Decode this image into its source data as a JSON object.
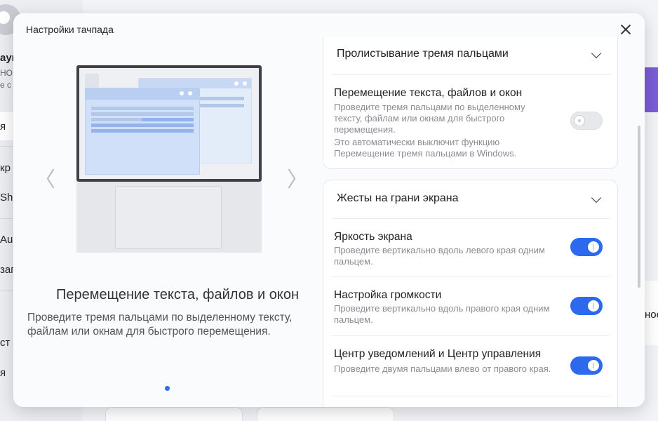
{
  "background": {
    "sidebar_fragments": [
      "аун",
      "HOM",
      "е с",
      "я",
      "кр",
      "Sh",
      "Aud",
      "зап",
      "ст",
      "я"
    ],
    "right_fragment": "ное"
  },
  "dialog": {
    "title": "Настройки тачпада",
    "close_icon": "close-icon"
  },
  "preview": {
    "prev_arrow": "〈",
    "next_arrow": "〉",
    "feature_title": "Перемещение текста, файлов и окон",
    "feature_description": "Проведите тремя пальцами по выделенному тексту, файлам или окнам для быстрого перемещения.",
    "page_indicator": "1"
  },
  "settings": {
    "three_finger_section": {
      "header": "Пролистывание тремя пальцами",
      "items": [
        {
          "title": "Перемещение текста, файлов и окон",
          "description": "Проведите тремя пальцами по выделенному тексту, файлам или окнам для быстрого перемещения.",
          "note": "Это автоматически выключит функцию Перемещение тремя пальцами в Windows.",
          "enabled": false
        }
      ]
    },
    "edge_section": {
      "header": "Жесты на грани экрана",
      "items": [
        {
          "title": "Яркость экрана",
          "description": "Проведите вертикально вдоль левого края одним пальцем.",
          "enabled": true
        },
        {
          "title": "Настройка громкости",
          "description": "Проведите вертикально вдоль правого края одним пальцем.",
          "enabled": true
        },
        {
          "title": "Центр уведомлений и Центр управления",
          "description": "Проведите двумя пальцами влево от правого края.",
          "enabled": true
        }
      ]
    }
  },
  "colors": {
    "accent": "#2d69ee",
    "dialog_bg": "#fafbfd"
  }
}
